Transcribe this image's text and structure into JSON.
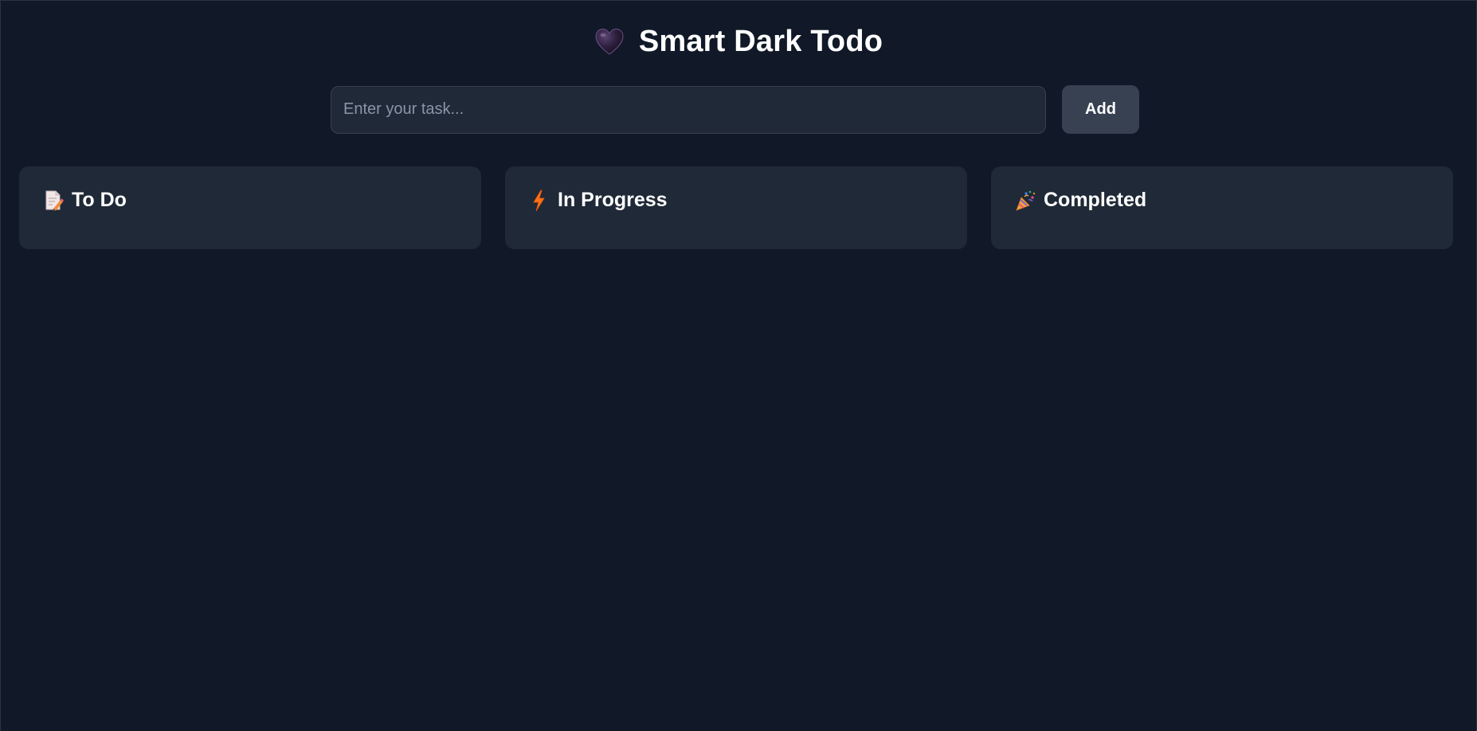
{
  "app": {
    "title": "Smart Dark Todo",
    "title_icon": "black-heart-icon"
  },
  "task_form": {
    "input_value": "",
    "input_placeholder": "Enter your task...",
    "add_label": "Add"
  },
  "columns": [
    {
      "title": "To Do",
      "icon": "memo-icon",
      "tasks": []
    },
    {
      "title": "In Progress",
      "icon": "lightning-icon",
      "tasks": []
    },
    {
      "title": "Completed",
      "icon": "party-popper-icon",
      "tasks": []
    }
  ],
  "colors": {
    "background": "#111827",
    "panel": "#1f2937",
    "button": "#374151",
    "input_border": "#374151",
    "lightning": "#f97316",
    "heart": "#2d1f3d"
  }
}
